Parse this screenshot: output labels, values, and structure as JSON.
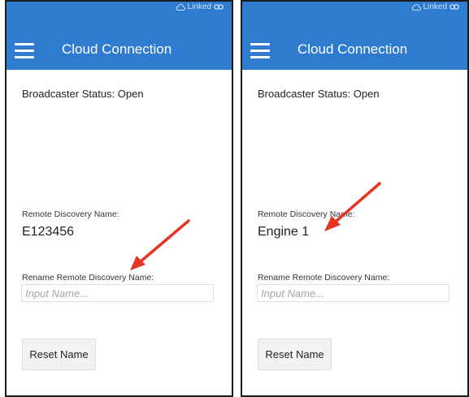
{
  "colors": {
    "appbar": "#2f7bd0",
    "arrow": "#e53324",
    "frame": "#1a1a1a"
  },
  "screens": [
    {
      "status_link": "Linked",
      "status_icons": [
        "cloud-icon",
        "link-icon"
      ],
      "menu_icon": "hamburger-menu-icon",
      "title": "Cloud Connection",
      "broadcaster_status": "Broadcaster Status: Open",
      "remote_label": "Remote Discovery Name:",
      "remote_value": "E123456",
      "rename_label": "Rename Remote Discovery Name:",
      "input_placeholder": "Input Name...",
      "reset_label": "Reset Name"
    },
    {
      "status_link": "Linked",
      "status_icons": [
        "cloud-icon",
        "link-icon"
      ],
      "menu_icon": "hamburger-menu-icon",
      "title": "Cloud Connection",
      "broadcaster_status": "Broadcaster Status: Open",
      "remote_label": "Remote Discovery Name:",
      "remote_value": "Engine 1",
      "rename_label": "Rename Remote Discovery Name:",
      "input_placeholder": "Input Name...",
      "reset_label": "Reset Name"
    }
  ]
}
